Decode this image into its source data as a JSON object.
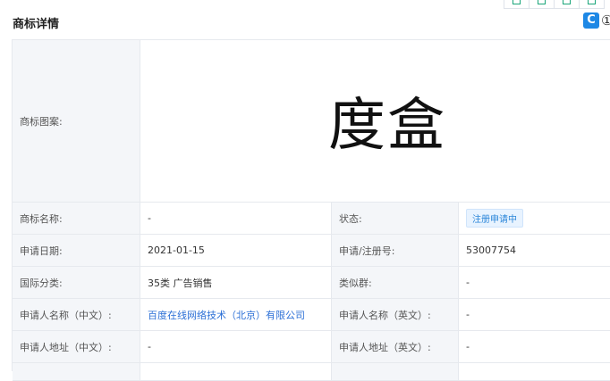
{
  "header": {
    "title": "商标详情",
    "brand_icon": "C"
  },
  "mark": {
    "image_label": "商标图案:",
    "image_text": "度盒"
  },
  "rows": [
    {
      "l1": "商标名称:",
      "v1": "-",
      "l2": "状态:",
      "v2": "注册申请中"
    },
    {
      "l1": "申请日期:",
      "v1": "2021-01-15",
      "l2": "申请/注册号:",
      "v2": "53007754"
    },
    {
      "l1": "国际分类:",
      "v1": "35类 广告销售",
      "l2": "类似群:",
      "v2": "-"
    },
    {
      "l1": "申请人名称（中文）:",
      "v1": "百度在线网络技术（北京）有限公司",
      "l2": "申请人名称（英文）:",
      "v2": "-"
    },
    {
      "l1": "申请人地址（中文）:",
      "v1": "-",
      "l2": "申请人地址（英文）:",
      "v2": "-"
    }
  ],
  "colors": {
    "accent": "#1aa57a",
    "link": "#2b6fd6",
    "badge_bg": "#e8f3ff",
    "label_bg": "#f4f6f9"
  }
}
